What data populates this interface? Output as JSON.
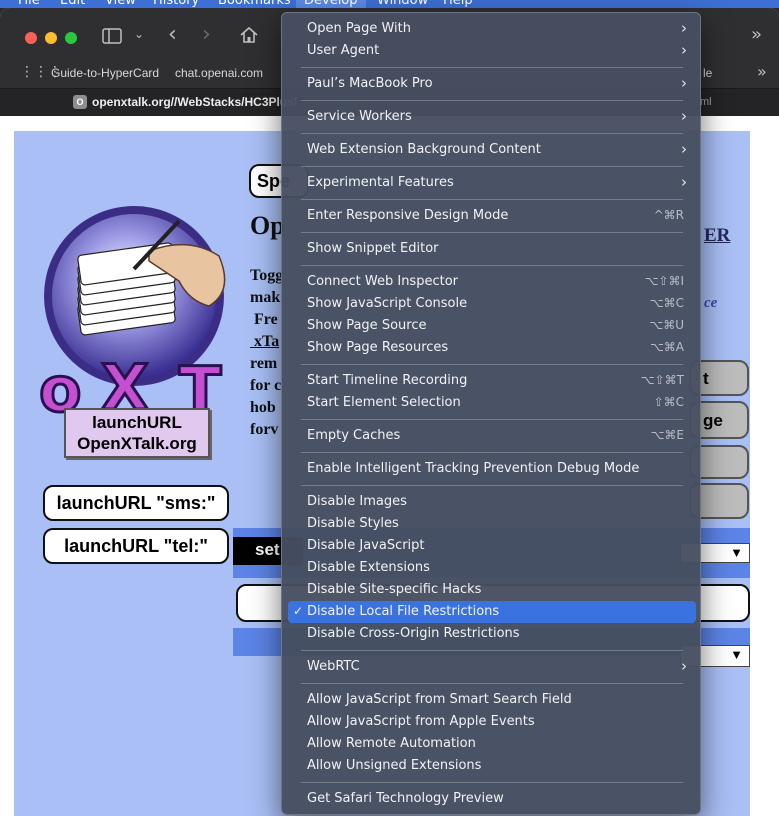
{
  "menubar": {
    "items": [
      "File",
      "Edit",
      "View",
      "History",
      "Bookmarks",
      "Develop",
      "Window",
      "Help"
    ],
    "active": "Develop"
  },
  "toolbar": {
    "sidebar_icon": "sidebar-icon",
    "back_icon": "chevron-left-icon",
    "forward_icon": "chevron-right-icon",
    "home_icon": "home-icon",
    "overflow_icon": "double-chevron-icon"
  },
  "favorites": {
    "items": [
      "Guide-to-HyperCard",
      "chat.openai.com"
    ],
    "partial_right": "le"
  },
  "tab": {
    "favicon_letter": "O",
    "url": "openxtalk.org//WebStacks/HC3Plusl",
    "partial_right": "ml"
  },
  "page": {
    "sp_label": "Spe",
    "op_label": "Op",
    "er_label": "ER",
    "body_lines": [
      "Togg",
      "mak",
      " Fre",
      " xTa",
      "rem",
      "for c",
      "hob",
      "forv"
    ],
    "italic_right": "ce",
    "launch_box_line1": "launchURL",
    "launch_box_line2": "OpenXTalk.org",
    "sms_button": "launchURL \"sms:\"",
    "tel_button": "launchURL \"tel:\"",
    "grey_btn_1": "t",
    "grey_btn_2": "ge",
    "black_label": "set"
  },
  "menu": {
    "groups": [
      [
        {
          "label": "Open Page With",
          "submenu": true
        },
        {
          "label": "User Agent",
          "submenu": true
        }
      ],
      [
        {
          "label": "Paul’s MacBook Pro",
          "submenu": true
        }
      ],
      [
        {
          "label": "Service Workers",
          "submenu": true
        }
      ],
      [
        {
          "label": "Web Extension Background Content",
          "submenu": true
        }
      ],
      [
        {
          "label": "Experimental Features",
          "submenu": true
        }
      ],
      [
        {
          "label": "Enter Responsive Design Mode",
          "shortcut": "^⌘R"
        }
      ],
      [
        {
          "label": "Show Snippet Editor"
        }
      ],
      [
        {
          "label": "Connect Web Inspector",
          "shortcut": "⌥⇧⌘I"
        },
        {
          "label": "Show JavaScript Console",
          "shortcut": "⌥⌘C"
        },
        {
          "label": "Show Page Source",
          "shortcut": "⌥⌘U"
        },
        {
          "label": "Show Page Resources",
          "shortcut": "⌥⌘A"
        }
      ],
      [
        {
          "label": "Start Timeline Recording",
          "shortcut": "⌥⇧⌘T"
        },
        {
          "label": "Start Element Selection",
          "shortcut": "⇧⌘C"
        }
      ],
      [
        {
          "label": "Empty Caches",
          "shortcut": "⌥⌘E"
        }
      ],
      [
        {
          "label": "Enable Intelligent Tracking Prevention Debug Mode"
        }
      ],
      [
        {
          "label": "Disable Images"
        },
        {
          "label": "Disable Styles"
        },
        {
          "label": "Disable JavaScript"
        },
        {
          "label": "Disable Extensions"
        },
        {
          "label": "Disable Site-specific Hacks"
        },
        {
          "label": "Disable Local File Restrictions",
          "checked": true,
          "selected": true
        },
        {
          "label": "Disable Cross-Origin Restrictions"
        }
      ],
      [
        {
          "label": "WebRTC",
          "submenu": true
        }
      ],
      [
        {
          "label": "Allow JavaScript from Smart Search Field"
        },
        {
          "label": "Allow JavaScript from Apple Events"
        },
        {
          "label": "Allow Remote Automation"
        },
        {
          "label": "Allow Unsigned Extensions"
        }
      ],
      [
        {
          "label": "Get Safari Technology Preview"
        }
      ]
    ],
    "checkmark": "✓",
    "submenu_glyph": "›"
  },
  "colors": {
    "menu_highlight": "#3a72e0",
    "page_bg": "#a9bff5"
  }
}
